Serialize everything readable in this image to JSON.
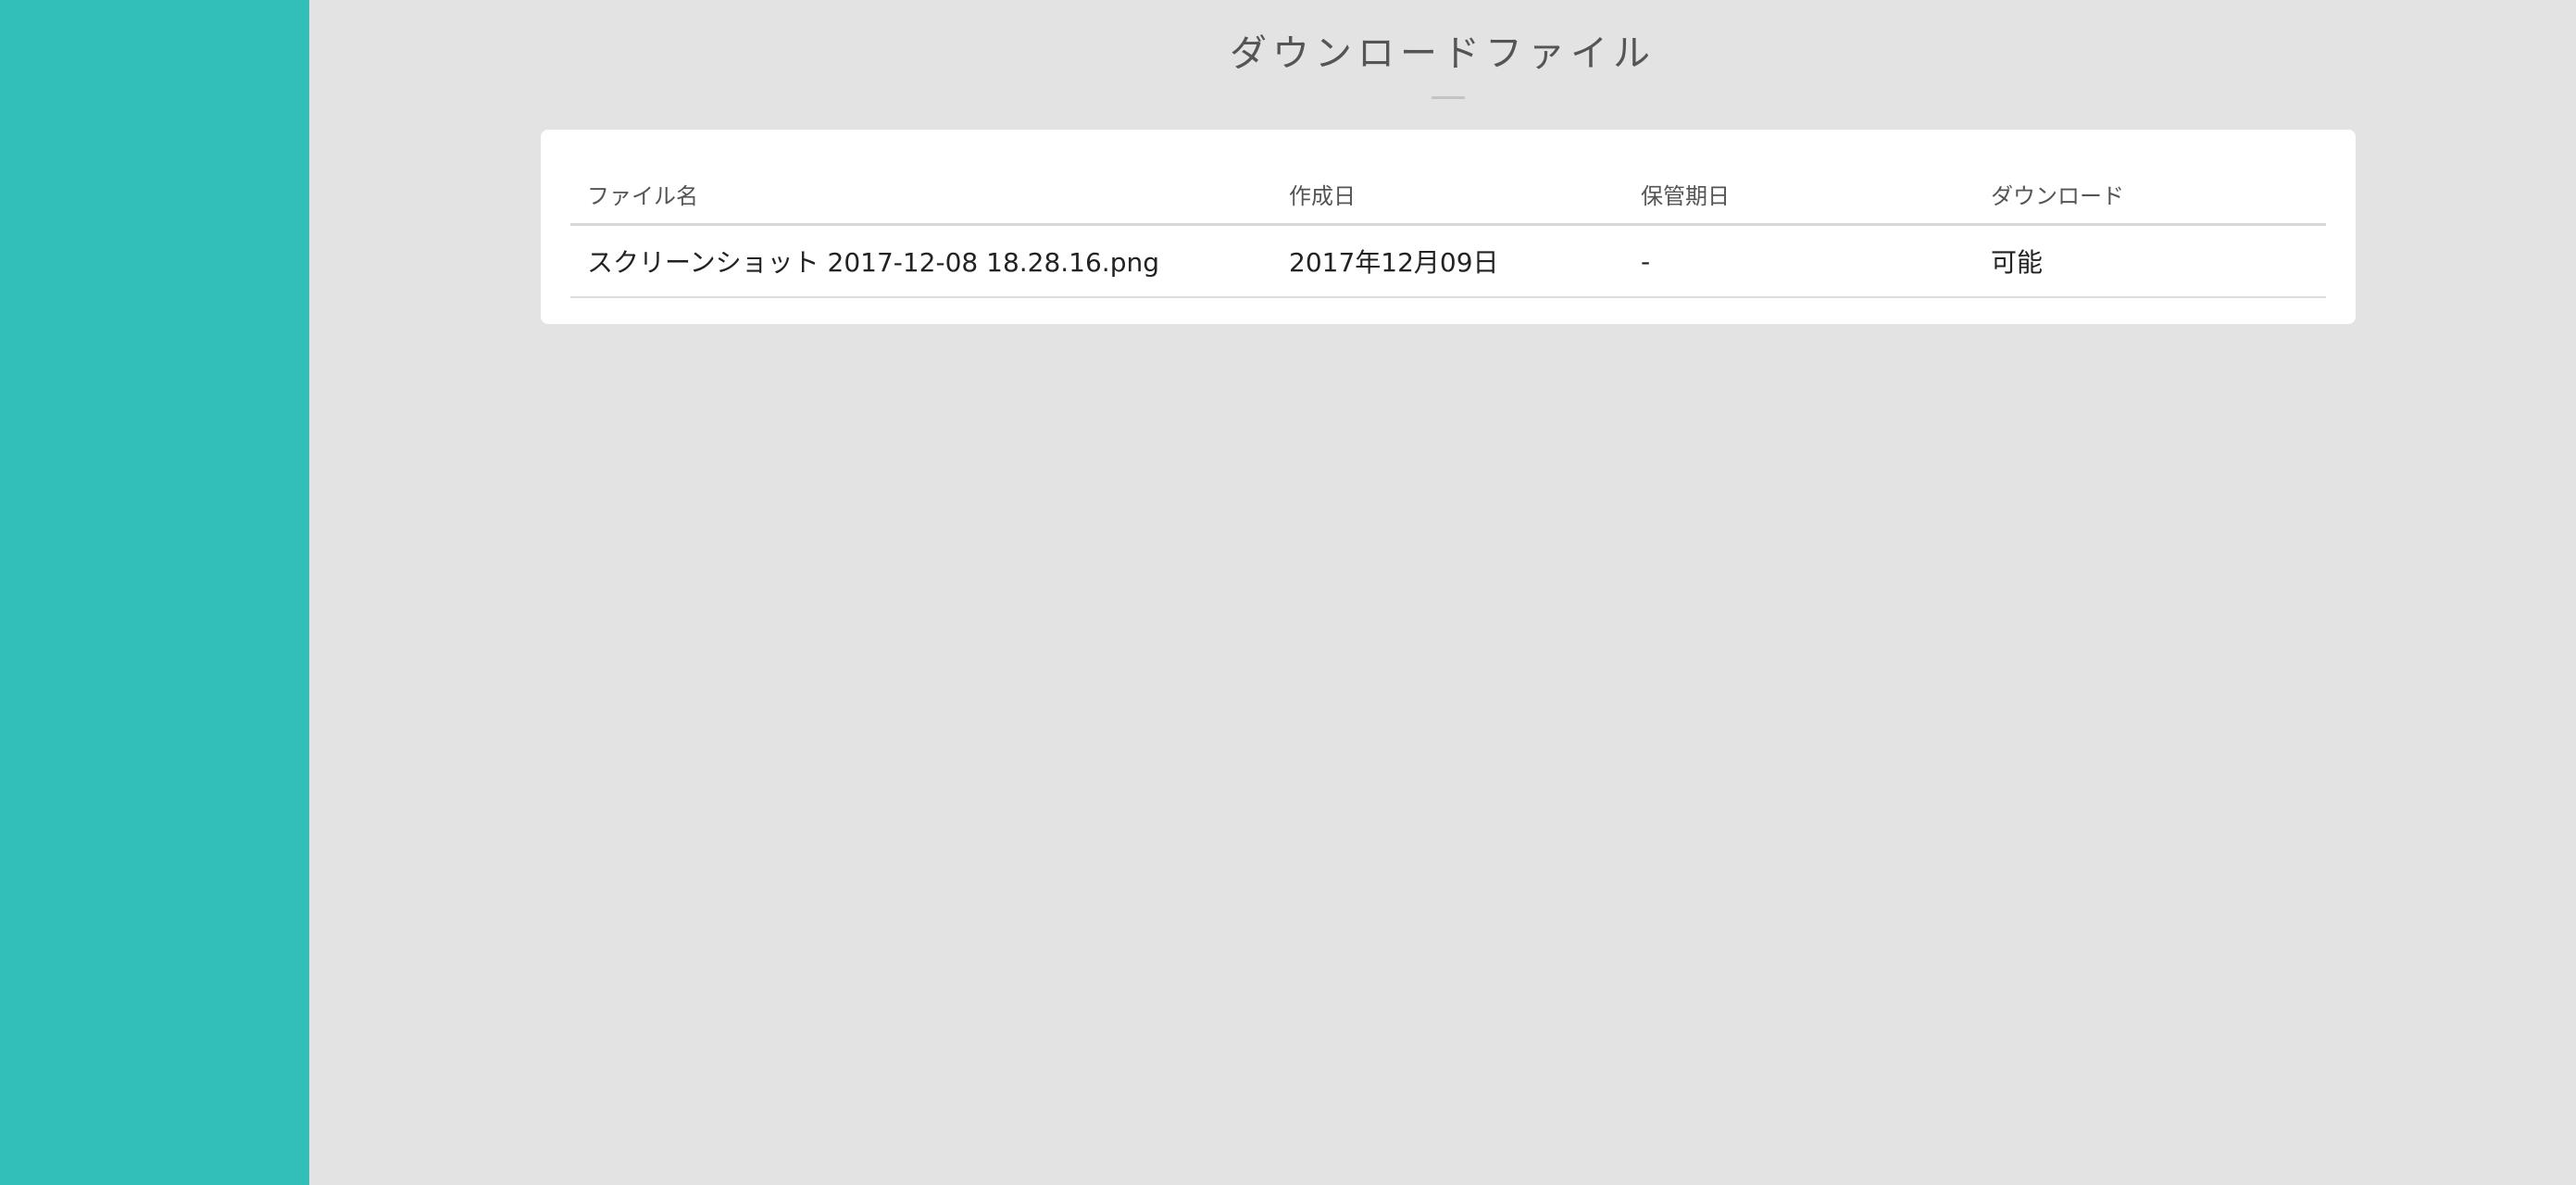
{
  "colors": {
    "sidebar": "#33bfb9",
    "background": "#e3e3e3",
    "card": "#ffffff"
  },
  "page": {
    "title": "ダウンロードファイル"
  },
  "table": {
    "headers": {
      "file_name": "ファイル名",
      "created": "作成日",
      "retention": "保管期日",
      "download": "ダウンロード"
    },
    "rows": [
      {
        "file_name": "スクリーンショット 2017-12-08 18.28.16.png",
        "created": "2017年12月09日",
        "retention": "-",
        "download": "可能"
      }
    ]
  }
}
